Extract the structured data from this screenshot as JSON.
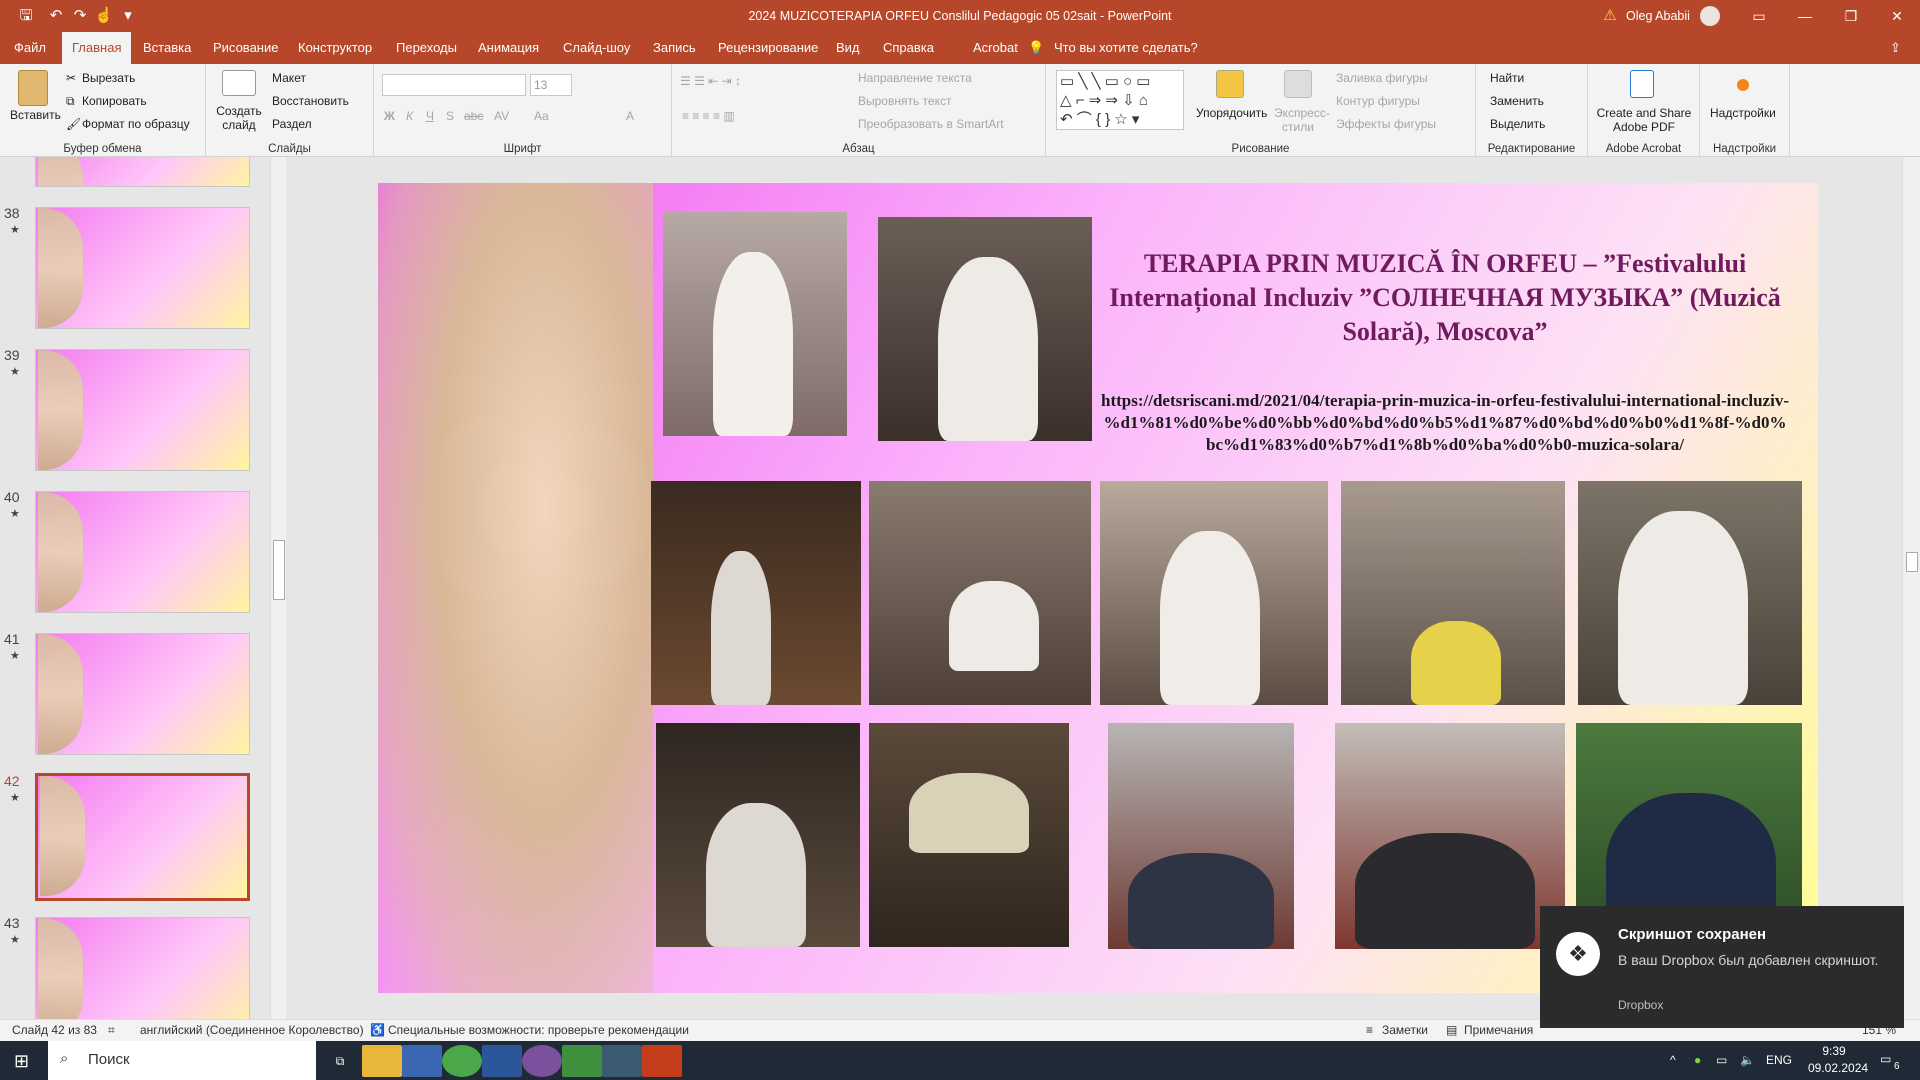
{
  "app": {
    "title": "2024 MUZICOTERAPIA ORFEU Conslilul Pedagogic 05 02sait  -  PowerPoint",
    "user": "Oleg Ababii",
    "accent": "#b7472a"
  },
  "menu": {
    "tabs": [
      "Файл",
      "Главная",
      "Вставка",
      "Рисование",
      "Конструктор",
      "Переходы",
      "Анимация",
      "Слайд-шоу",
      "Запись",
      "Рецензирование",
      "Вид",
      "Справка",
      "Acrobat"
    ],
    "active": "Главная",
    "search": "Что вы хотите сделать?"
  },
  "ribbon": {
    "clipboard": {
      "paste": "Вставить",
      "cut": "Вырезать",
      "copy": "Копировать",
      "format": "Формат по образцу",
      "label": "Буфер обмена"
    },
    "slides": {
      "new": "Создать слайд",
      "layout": "Макет",
      "reset": "Восстановить",
      "section": "Раздел",
      "label": "Слайды"
    },
    "font": {
      "size": "13",
      "label": "Шрифт",
      "bold": "Ж",
      "italic": "К",
      "underline": "Ч",
      "strike": "S",
      "abc": "abc",
      "spacing": "AV",
      "case": "Aa",
      "color": "A"
    },
    "paragraph": {
      "dir": "Направление текста",
      "align": "Выровнять текст",
      "smartart": "Преобразовать в SmartArt",
      "label": "Абзац"
    },
    "drawing": {
      "arrange": "Упорядочить",
      "quick": "Экспресс-стили",
      "fill": "Заливка фигуры",
      "outline": "Контур фигуры",
      "effects": "Эффекты фигуры",
      "label": "Рисование"
    },
    "editing": {
      "find": "Найти",
      "replace": "Заменить",
      "select": "Выделить",
      "label": "Редактирование"
    },
    "acrobat": {
      "create": "Create and Share Adobe PDF",
      "label": "Adobe Acrobat"
    },
    "addins": {
      "btn": "Надстройки",
      "label": "Надстройки"
    }
  },
  "thumbnails": [
    {
      "num": "38",
      "star": "★"
    },
    {
      "num": "39",
      "star": "★"
    },
    {
      "num": "40",
      "star": "★"
    },
    {
      "num": "41",
      "star": "★"
    },
    {
      "num": "42",
      "star": "★"
    },
    {
      "num": "43",
      "star": "★"
    }
  ],
  "slide": {
    "title": "TERAPIA PRIN MUZICĂ ÎN ORFEU – ”Festivalului Internațional Incluziv ”СОЛНЕЧНАЯ МУЗЫКА” (Muzică Solară), Moscova”",
    "link": "https://detsriscani.md/2021/04/terapia-prin-muzica-in-orfeu-festivalului-international-incluziv-%d1%81%d0%be%d0%bb%d0%bd%d0%b5%d1%87%d0%bd%d0%b0%d1%8f-%d0%bc%d1%83%d0%b7%d1%8b%d0%ba%d0%b0-muzica-solara/"
  },
  "status": {
    "slide": "Слайд 42 из 83",
    "lang": "английский (Соединенное Королевство)",
    "access": "Специальные возможности: проверьте рекомендации",
    "notes": "Заметки",
    "comments": "Примечания",
    "zoom": "151 %"
  },
  "toast": {
    "title": "Скриншот сохранен",
    "body": "В ваш Dropbox был добавлен скриншот.",
    "source": "Dropbox"
  },
  "taskbar": {
    "search": "Поиск",
    "lang": "ENG",
    "time": "9:39",
    "date": "09.02.2024",
    "notif": "6"
  }
}
